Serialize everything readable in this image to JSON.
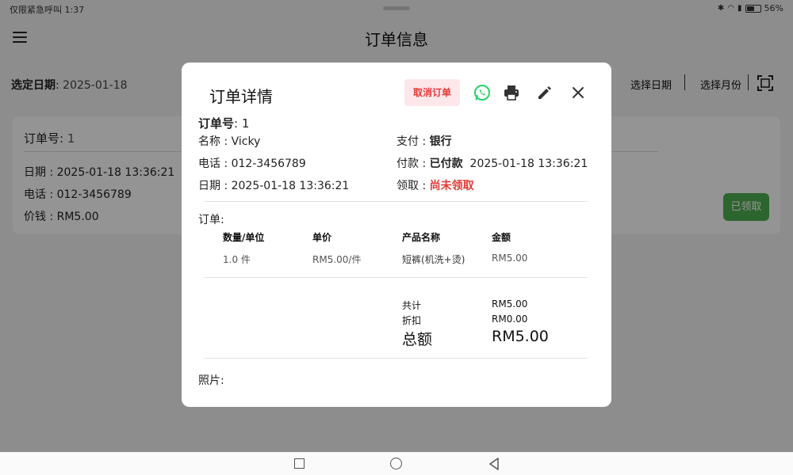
{
  "status_bar": {
    "left_text": "仅限紧急呼叫 1:37",
    "battery": "56%",
    "battery_level": 0.56
  },
  "app": {
    "title": "订单信息",
    "selected_date_label": "选定日期",
    "selected_date_value": "2025-01-18",
    "filters": [
      "选择日期",
      "选择月份"
    ]
  },
  "order_card": {
    "order_no_label": "订单号",
    "order_no": "1",
    "date_line": "日期 : 2025-01-18 13:36:21",
    "phone_line": "电话 : 012-3456789",
    "price_line": "价钱 : RM5.00",
    "picked_button": "已领取"
  },
  "dialog": {
    "title": "订单详情",
    "cancel_button": "取消订单",
    "order_no_label": "订单号",
    "order_no": "1",
    "name_line": "名称 : Vicky",
    "phone_line": "电话 : 012-3456789",
    "date_line": "日期 : 2025-01-18 13:36:21",
    "payment_method_label": "支付 : ",
    "payment_method": "银行",
    "payment_status_label": "付款 : ",
    "payment_status": "已付款",
    "payment_time": "2025-01-18 13:36:21",
    "pickup_label": "领取 : ",
    "pickup_status": "尚未领取",
    "order_section_label": "订单:",
    "table_headers": [
      "数量/单位",
      "单价",
      "产品名称",
      "金额"
    ],
    "table_rows": [
      [
        "1.0 件",
        "RM5.00/件",
        "短裤(机洗+烫)",
        "RM5.00"
      ]
    ],
    "subtotal_label": "共计",
    "subtotal": "RM5.00",
    "discount_label": "折扣",
    "discount": "RM0.00",
    "total_label": "总额",
    "total": "RM5.00",
    "photo_label": "照片:"
  },
  "colors": {
    "accent_red": "#e53935",
    "green": "#4caf50",
    "whatsapp": "#25d366"
  },
  "icons": [
    "menu-icon",
    "scan-icon",
    "whatsapp-icon",
    "print-icon",
    "edit-icon",
    "close-icon"
  ]
}
